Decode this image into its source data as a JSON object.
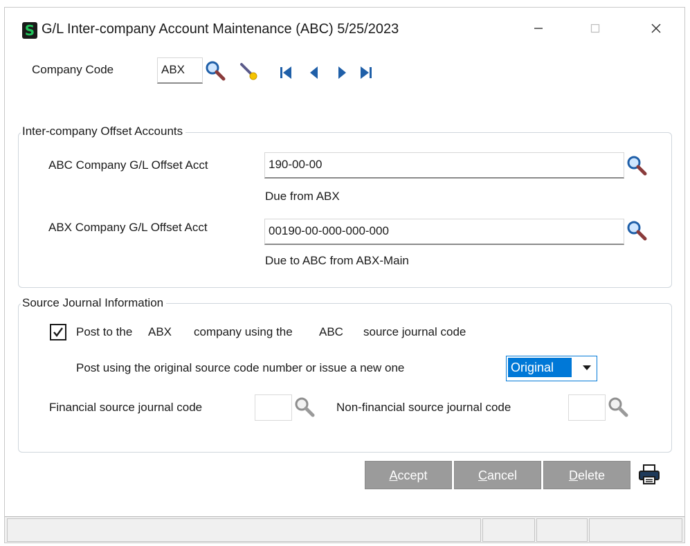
{
  "window": {
    "title": "G/L Inter-company Account Maintenance (ABC) 5/25/2023",
    "app_icon_letter": "S"
  },
  "header": {
    "company_code_label": "Company Code",
    "company_code_value": "ABX"
  },
  "offset_accounts": {
    "legend": "Inter-company Offset Accounts",
    "rows": [
      {
        "label": "ABC  Company G/L Offset Acct",
        "value": "190-00-00",
        "description": "Due from ABX"
      },
      {
        "label": "ABX  Company G/L Offset Acct",
        "value": "00190-00-000-000-000",
        "description": "Due to ABC from ABX-Main"
      }
    ]
  },
  "source_journal": {
    "legend": "Source Journal Information",
    "post_checkbox_checked": true,
    "post_label_part1": "Post to the",
    "post_label_company": "ABX",
    "post_label_part2": "company using the",
    "post_label_source_company": "ABC",
    "post_label_part3": "source journal code",
    "original_label": "Post using the original source code number or issue a new one",
    "original_selected": "Original",
    "financial_label": "Financial source journal code",
    "financial_value": "",
    "nonfinancial_label": "Non-financial source journal  code",
    "nonfinancial_value": ""
  },
  "buttons": {
    "accept_hot": "A",
    "accept_rest": "ccept",
    "cancel_hot": "C",
    "cancel_rest": "ancel",
    "delete_hot": "D",
    "delete_rest": "elete"
  }
}
